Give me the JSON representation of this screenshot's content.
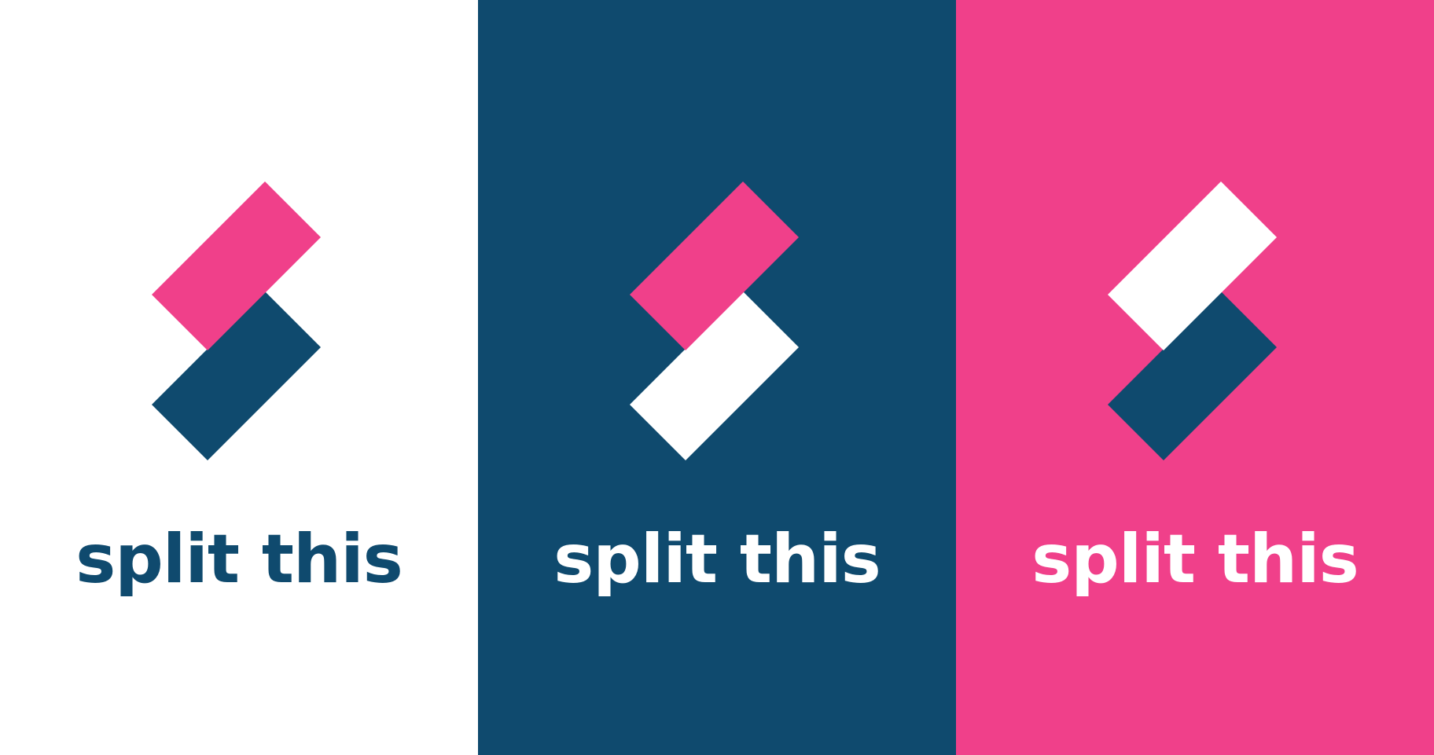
{
  "panels": [
    {
      "id": "white",
      "background": "#ffffff",
      "top_bar_color": "#f0408a",
      "bottom_bar_color": "#0f4a6e",
      "text_color": "#0f4a6e",
      "wordmark": "split this"
    },
    {
      "id": "navy",
      "background": "#0f4a6e",
      "top_bar_color": "#f0408a",
      "bottom_bar_color": "#ffffff",
      "text_color": "#ffffff",
      "wordmark": "split this"
    },
    {
      "id": "pink",
      "background": "#f0408a",
      "top_bar_color": "#ffffff",
      "bottom_bar_color": "#0f4a6e",
      "text_color": "#ffffff",
      "wordmark": "split this"
    }
  ],
  "icon": "split-this-logo-icon"
}
